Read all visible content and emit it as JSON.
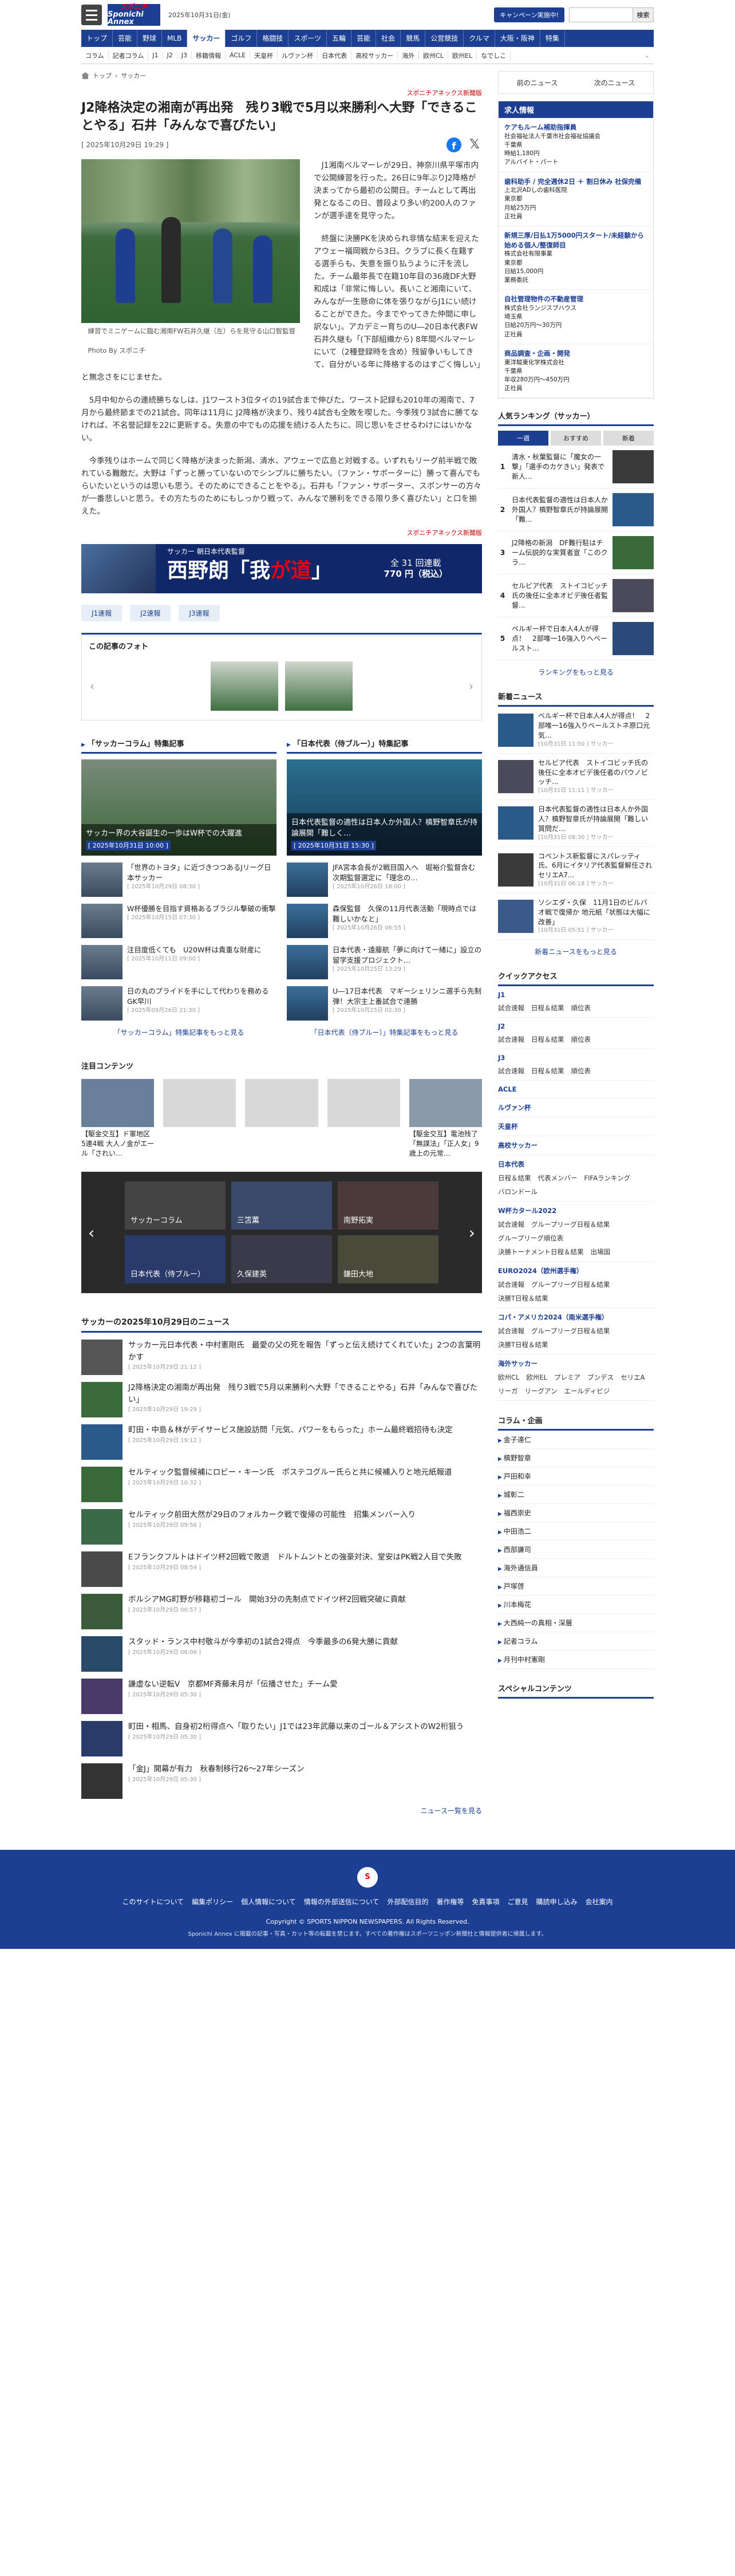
{
  "header": {
    "logo_line1": "スポニチ",
    "logo_line2": "Sponichi Annex",
    "date": "2025年10月31日(金)",
    "campaign": "キャンペーン実施中!",
    "search_placeholder": "",
    "search_button": "検索"
  },
  "gnav": [
    "トップ",
    "芸能",
    "野球",
    "MLB",
    "サッカー",
    "ゴルフ",
    "格闘技",
    "スポーツ",
    "五輪",
    "芸能",
    "社会",
    "競馬",
    "公営競技",
    "クルマ",
    "大阪・阪神",
    "特集"
  ],
  "snav": [
    "コラム",
    "記者コラム",
    "J1",
    "J2",
    "J3",
    "移籍情報",
    "ACLE",
    "天皇杯",
    "ルヴァン杯",
    "日本代表",
    "高校サッカー",
    "海外",
    "欧州CL",
    "欧州EL",
    "なでしこ"
  ],
  "breadcrumb": [
    "トップ",
    "サッカー"
  ],
  "source": "スポニチアネックス新聞版",
  "title": "J2降格決定の湘南が再出発　残り3戦で5月以来勝利へ大野「できることやる」石井「みんなで喜びたい」",
  "date": "[ 2025年10月29日 19:29 ]",
  "photo_caption": "練習でミニゲームに臨む湘南FW石井久継（左）らを見守る山口智監督",
  "photo_credit": "Photo By スポニチ",
  "paragraphs": [
    "J1湘南ベルマーレが29日、神奈川県平塚市内で公開練習を行った。26日に9年ぶりJ2降格が決まってから最初の公開日。チームとして再出発となるこの日、普段より多い約200人のファンが選手達を見守った。",
    "終盤に決勝PKを決められ非情な結末を迎えたアウェー福岡戦から3日。クラブに長く在籍する選手らも、失意を振り払うように汗を流した。チーム最年長で在籍10年目の36歳DF大野和成は「非常に悔しい。長いこと湘南にいて、みんなが一生懸命に体を張りながらJ1にい続けることができた。今までやってきた仲間に申し訳ない」。アカデミー育ちのU―20日本代表FW石井久継も「(下部組織から) 8年間ベルマーレにいて（2種登録時を含め）残留争いもしてきて、自分がいる年に降格するのはすごく悔しい」と無念さをにじませた。",
    "5月中旬からの連続勝ちなしは、J1ワースト3位タイの19試合まで伸びた。ワースト記録も2010年の湘南で、7月から最終節までの21試合。同年は11月に J2降格が決まり、残り4試合も全敗を喫した。今季残り3試合に勝てなければ、不名誉記録を22に更新する。失意の中でもの応援を続ける人たちに、同じ思いをさせるわけにはいかない。",
    "今季残りはホームで同じく降格が決まった新潟、清水、アウェーで広島と対戦する。いずれもリーグ前半戦で敗れている難敵だ。大野は「ずっと勝っていないのでシンプルに勝ちたい。（ファン・サポーターに）勝って喜んでもらいたいというのは思いも思う。そのためにできることをやる」。石井も「ファン・サポーター、スポンサーの方々が一番悲しいと思う。その方たちのためにもしっかり戦って、みんなで勝利をできる限り多く喜びたい」と口を揃えた。"
  ],
  "source_bottom": "スポニチアネックス新聞版",
  "banner": {
    "top": "サッカー 朝日本代表監督",
    "name_pre": "西野朗「我",
    "name_em": "が道",
    "name_post": "」",
    "price1": "全 31 回連載",
    "price2": "770 円（税込）"
  },
  "tags": [
    "J1速報",
    "J2速報",
    "J3速報"
  ],
  "gallery_title": "この記事のフォト",
  "col1": {
    "title": "「サッカーコラム」特集記事",
    "big_title": "サッカー界の大谷誕生の一歩はW杯での大躍進",
    "big_date": "[ 2025年10月31日 10:00 ]",
    "items": [
      {
        "t": "「世界のトヨタ」に近づきつつあるJリーグ日本サッカー",
        "d": "[ 2025年10月29日 08:30 ]"
      },
      {
        "t": "W杯優勝を目指す資格あるブラジル撃破の衝撃",
        "d": "[ 2025年10月15日 07:30 ]"
      },
      {
        "t": "注目度低くても　U20W杯は貴重な財産に",
        "d": "[ 2025年10月11日 09:00 ]"
      },
      {
        "t": "日の丸のプライドを手にして代わりを務めるGK早川",
        "d": "[ 2025年09月26日 21:30 ]"
      }
    ],
    "more": "「サッカーコラム」特集記事をもっと見る"
  },
  "col2": {
    "title": "「日本代表（侍ブルー）」特集記事",
    "big_title": "日本代表監督の適性は日本人か外国人？槙野智章氏が持論展開「難しく…",
    "big_date": "[ 2025年10月31日 15:30 ]",
    "items": [
      {
        "t": "JFA宮本会長が2戦目国入へ　堀裕介監督含む次期監督選定に「理念の…",
        "d": "[ 2025年10月26日 18:00 ]"
      },
      {
        "t": "森保監督　久保の11月代表活動「現時点では難しいかなと」",
        "d": "[ 2025年10月26日 06:55 ]"
      },
      {
        "t": "日本代表・遠藤航「夢に向けて一緒に」設立の留学支援プロジェクト…",
        "d": "[ 2025年10月25日 13:29 ]"
      },
      {
        "t": "U―17日本代表　マギーシェリンニ選手ら先制弾！大宗主上番試合で連勝",
        "d": "[ 2025年10月25日 02:30 ]"
      }
    ],
    "more": "「日本代表（侍ブルー）」特集記事をもっと見る"
  },
  "attention": {
    "title": "注目コンテンツ",
    "items": [
      "【駆金交互】ド軍地区5連4戦 大人ノ金がエール「されい…",
      "",
      "",
      "",
      "【駆金交互】電池残了「無謀法」「正人女」9歳上の元常…"
    ],
    "rec": "Recommended by"
  },
  "carousel": [
    "サッカーコラム",
    "三笘薫",
    "南野拓実",
    "日本代表（侍ブルー）",
    "久保建英",
    "鎌田大地"
  ],
  "news": {
    "title": "サッカーの2025年10月29日のニュース",
    "items": [
      {
        "t": "サッカー元日本代表・中村憲剛氏　最愛の父の死を報告「ずっと伝え続けてくれていた」2つの言葉明かす",
        "d": "[ 2025年10月29日 21:12 ]"
      },
      {
        "t": "J2降格決定の湘南が再出発　残り3戦で5月以来勝利へ大野「できることやる」石井「みんなで喜びたい」",
        "d": "[ 2025年10月29日 19:29 ]"
      },
      {
        "t": "町田・中島＆林がデイサービス施設訪問「元気、パワーをもらった」ホーム最終戦招待も決定",
        "d": "[ 2025年10月29日 19:12 ]"
      },
      {
        "t": "セルティック監督候補にロビー・キーン氏　ポステコグルー氏らと共に候補入りと地元紙報道",
        "d": "[ 2025年10月29日 10:32 ]"
      },
      {
        "t": "セルティック前田大然が29日のフォルカーク戦で復帰の可能性　招集メンバー入り",
        "d": "[ 2025年10月29日 09:56 ]"
      },
      {
        "t": "Eフランクフルトはドイツ杯2回戦で敗退　ドルトムントとの強豪対決、堂安はPK戦2人目で失敗",
        "d": "[ 2025年10月29日 08:54 ]"
      },
      {
        "t": "ボルシアMG町野が移籍初ゴール　開始3分の先制点でドイツ杯2回戦突破に貢献",
        "d": "[ 2025年10月29日 06:57 ]"
      },
      {
        "t": "スタッド・ランス中村敬斗が今季初の1試合2得点　今季最多の6発大勝に貢献",
        "d": "[ 2025年10月29日 06:06 ]"
      },
      {
        "t": "謙虚ない逆転V　京都MF斉藤未月が「伝播させた」チーム愛",
        "d": "[ 2025年10月29日 05:30 ]"
      },
      {
        "t": "町田・相馬、自身初2桁得点へ「取りたい」J1では23年武藤以来のゴール＆アシストのW2桁狙う",
        "d": "[ 2025年10月29日 05:30 ]"
      },
      {
        "t": "「金J」開幕が有力　秋春制移行26～27年シーズン",
        "d": "[ 2025年10月29日 05:30 ]"
      }
    ],
    "more": "ニュース一覧を見る"
  },
  "side": {
    "ad": [
      "前のニュース",
      "次のニュース"
    ],
    "job_title": "求人情報",
    "jobs": [
      {
        "t": "ケアもルーム補助指揮員",
        "s": "社会福祉法人千葉市社会福祉協議会",
        "a": "千葉県",
        "p": "時給1,180円",
        "k": "アルバイト・パート"
      },
      {
        "t": "歯科助手 / 完全週休2日 ＋ 割日休み 社保完備",
        "s": "上北沢ADしの歯科医院",
        "a": "東京都",
        "p": "月給25万円",
        "k": "正社員"
      },
      {
        "t": "新規三厚/日払1万5000円スタート/未経験から始める個人/整復師目",
        "s": "株式会社有限事業",
        "a": "東京都",
        "p": "日給15,000円",
        "k": "業務委託"
      },
      {
        "t": "自社管理物件の不動産管理",
        "s": "株式会社ランジスブハウス",
        "a": "埼玉県",
        "p": "日給20万円〜30万円",
        "k": "正社員"
      },
      {
        "t": "商品調査・企画・開発",
        "s": "東洋駿東化学株式会社",
        "a": "千葉県",
        "p": "年収280万円〜450万円",
        "k": "正社員"
      }
    ],
    "rank_title": "人気ランキング（サッカー）",
    "rank_tabs": [
      "一週",
      "おすすめ",
      "新着"
    ],
    "ranks": [
      "清水・秋葉監督に「魔女の一撃」「選手のカケきい」発表で新人...",
      "日本代表監督の適性は日本人か外国人？槙野智章氏が持論展開「難...",
      "J2降格の新潟　DF難行駐はチーム伝説的な実質者宣「このクラ...",
      "セルビア代表　ストイコビッチ氏の後任に全本オビデ後任者監督...",
      "ベルギー杯で日本人4人が得点！　2部唯一16強入りへベールスト..."
    ],
    "rank_more": "ランキングをもっと見る",
    "new_title": "新着ニュース",
    "new": [
      {
        "t": "ベルギー杯で日本人4人が得点！　2部唯一16強入りベールストネ原口元気...",
        "d": "[10月31日 11:50 ] サッカー"
      },
      {
        "t": "セルビア代表　ストイコビッチ氏の後任に全本オビデ後任者のパウノビッチ...",
        "d": "[10月31日 11:11 ] サッカー"
      },
      {
        "t": "日本代表監督の適性は日本人か外国人？槙野智章氏が持論展開「難しい質問だ...",
        "d": "[10月31日 08:30 ] サッカー"
      },
      {
        "t": "コベントス新監督にスパレッティ氏、6月にイタリア代表監督解任されセリエA7...",
        "d": "[10月31日 06:18 ] サッカー"
      },
      {
        "t": "ソシエダ・久保　11月1日のビルバオ戦で復帰か 地元紙「状態は大幅に改善」",
        "d": "[10月31日 05:51 ] サッカー"
      }
    ],
    "new_more": "新着ニュースをもっと見る",
    "qa_title": "クイックアクセス",
    "qa": [
      {
        "h": "J1",
        "i": [
          "試合速報",
          "日程＆結果",
          "順位表"
        ]
      },
      {
        "h": "J2",
        "i": [
          "試合速報",
          "日程＆結果",
          "順位表"
        ]
      },
      {
        "h": "J3",
        "i": [
          "試合速報",
          "日程＆結果",
          "順位表"
        ]
      },
      {
        "h": "ACLE",
        "i": []
      },
      {
        "h": "ルヴァン杯",
        "i": []
      },
      {
        "h": "天皇杯",
        "i": []
      },
      {
        "h": "高校サッカー",
        "i": []
      },
      {
        "h": "日本代表",
        "i": [
          "日程＆結果",
          "代表メンバー",
          "FIFAランキング",
          "バロンドール"
        ]
      },
      {
        "h": "W杯カタール2022",
        "i": [
          "試合速報",
          "グループリーグ日程＆結果",
          "グループリーグ順位表",
          "決勝トーナメント日程＆結果",
          "出場国"
        ]
      },
      {
        "h": "EURO2024（欧州選手権）",
        "i": [
          "試合速報",
          "グループリーグ日程＆結果",
          "決勝T日程＆結果"
        ]
      },
      {
        "h": "コパ・アメリカ2024（南米選手権）",
        "i": [
          "試合速報",
          "グループリーグ日程＆結果",
          "決勝T日程＆結果"
        ]
      },
      {
        "h": "海外サッカー",
        "i": [
          "欧州CL",
          "欧州EL",
          "プレミア",
          "ブンデス",
          "セリエA",
          "リーガ",
          "リーグアン",
          "エールディビジ"
        ]
      }
    ],
    "column_title": "コラム・企画",
    "columns": [
      "金子達仁",
      "槙野智章",
      "戸田和幸",
      "城彰二",
      "福西崇史",
      "中田浩二",
      "西部謙司",
      "海外通信員",
      "戸塚啓",
      "川本梅花",
      "大西純一の真相・深層",
      "記者コラム",
      "月刊中村憲剛"
    ],
    "special_title": "スペシャルコンテンツ"
  },
  "footer": {
    "links": [
      "このサイトについて",
      "編集ポリシー",
      "個人情報について",
      "情報の外部送信について",
      "外部配信目的",
      "著作権等",
      "免責事項",
      "ご意見",
      "購読申し込み",
      "会社案内"
    ],
    "copy": "Copyright © SPORTS NIPPON NEWSPAPERS. All Rights Reserved.",
    "copy2": "Sponichi Annex に掲載の記事・写真・カット等の転載を禁じます。すべての著作権はスポーツニッポン新聞社と情報提供者に帰属します。"
  }
}
